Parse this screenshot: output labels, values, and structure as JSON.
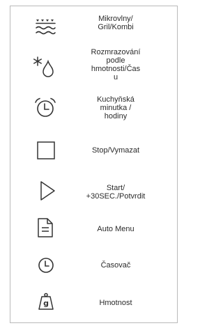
{
  "rows": [
    {
      "icon": "microwave-grill-icon",
      "label_lines": [
        "Mikrovlny/",
        "Gril/Kombi"
      ]
    },
    {
      "icon": "snowflake-drop-icon",
      "label_lines": [
        "Rozmrazování",
        "podle",
        "hmotnosti/Čas",
        "u"
      ]
    },
    {
      "icon": "alarm-clock-icon",
      "label_lines": [
        "Kuchyňská",
        "minutka /",
        "hodiny"
      ]
    },
    {
      "icon": "square-icon",
      "label_lines": [
        "Stop/Vymazat"
      ]
    },
    {
      "icon": "play-triangle-icon",
      "label_lines": [
        "Start/",
        "+30SEC./Potvrdit"
      ]
    },
    {
      "icon": "document-icon",
      "label_lines": [
        "Auto Menu"
      ]
    },
    {
      "icon": "clock-icon",
      "label_lines": [
        "Časovač"
      ]
    },
    {
      "icon": "weight-icon",
      "label_lines": [
        "Hmotnost"
      ]
    }
  ]
}
